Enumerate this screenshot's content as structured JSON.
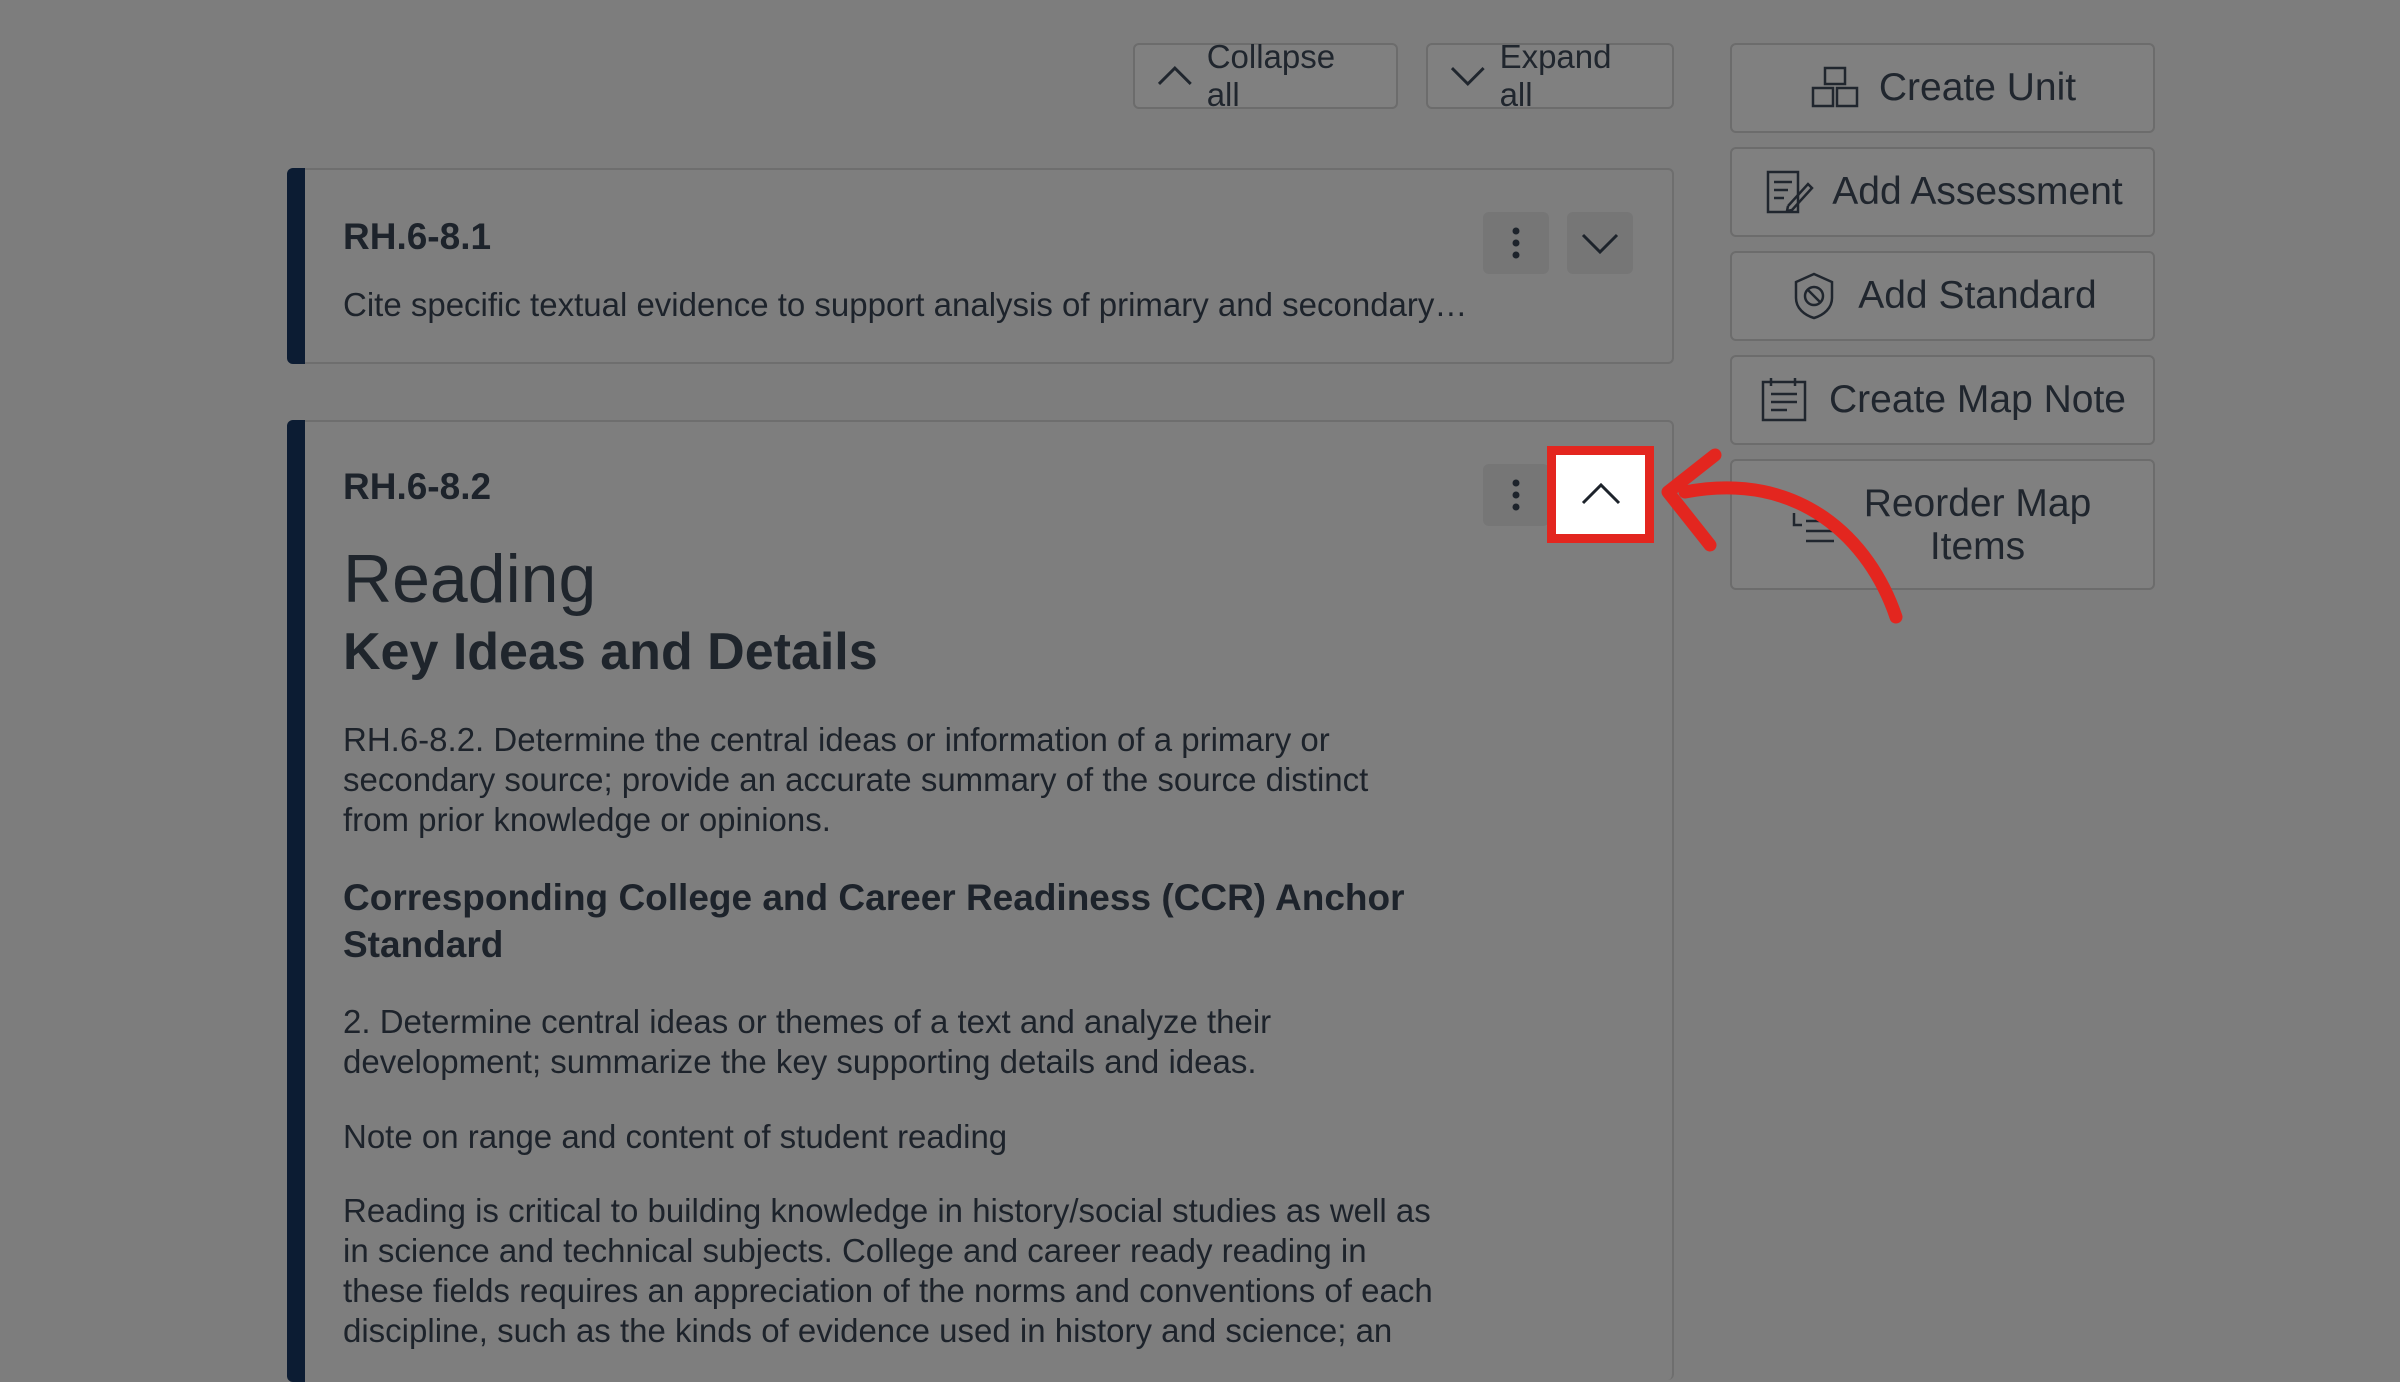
{
  "toolbar": {
    "collapse_all": "Collapse all",
    "expand_all": "Expand all"
  },
  "cards": [
    {
      "code": "RH.6-8.1",
      "summary": "Cite specific textual evidence to support analysis of primary and secondary…"
    },
    {
      "code": "RH.6-8.2",
      "heading": "Reading",
      "subheading": "Key Ideas and Details",
      "description": "RH.6-8.2. Determine the central ideas or information of a primary or secondary source; provide an accurate summary of the source distinct from prior knowledge or opinions.",
      "ccr_heading": "Corresponding College and Career Readiness (CCR) Anchor Standard",
      "ccr_text": "2. Determine central ideas or themes of a text and analyze their development; summarize the key supporting details and ideas.",
      "note_heading": "Note on range and content of student reading",
      "note_text": "Reading is critical to building knowledge in history/social studies as well as in science and technical subjects. College and career ready reading in these fields requires an appreciation of the norms and conventions of each discipline, such as the kinds of evidence used in history and science; an"
    }
  ],
  "sidebar": {
    "create_unit": "Create Unit",
    "add_assessment": "Add Assessment",
    "add_standard": "Add Standard",
    "create_map_note": "Create Map Note",
    "reorder_map_items": "Reorder Map Items"
  },
  "colors": {
    "overlay": "#7d7d7d",
    "card_stripe": "#0c1c33",
    "highlight": "#e3261f"
  }
}
